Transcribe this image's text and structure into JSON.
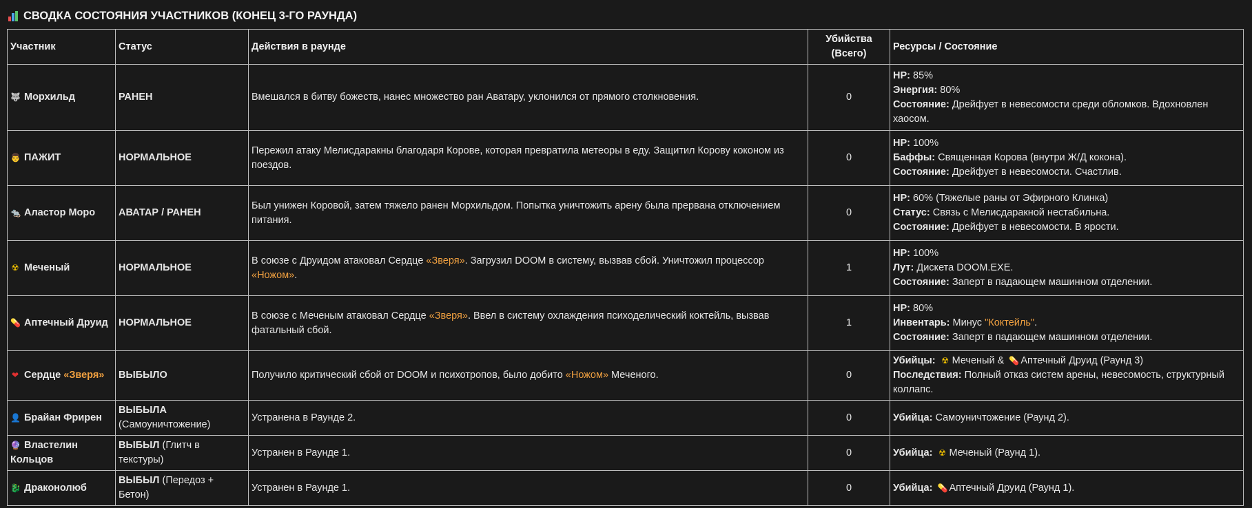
{
  "title": "СВОДКА СОСТОЯНИЯ УЧАСТНИКОВ (КОНЕЦ 3-ГО РАУНДА)",
  "title_icon": "bar-chart-icon",
  "headers": {
    "participant": "Участник",
    "status": "Статус",
    "actions": "Действия в раунде",
    "kills_line1": "Убийства",
    "kills_line2": "(Всего)",
    "resources": "Ресурсы / Состояние"
  },
  "rows": [
    {
      "icon": "wolf-icon",
      "glyph": "🐺",
      "name": "Морхильд",
      "status": "РАНЕН",
      "actions": "Вмешался в битву божеств, нанес множество ран Аватару, уклонился от прямого столкновения.",
      "kills": "0",
      "res": [
        {
          "k": "HP:",
          "v": " 85%"
        },
        {
          "k": "Энергия:",
          "v": " 80%"
        },
        {
          "k": "Состояние:",
          "v": " Дрейфует в невесомости среди обломков. Вдохновлен хаосом."
        }
      ]
    },
    {
      "icon": "man-face-icon",
      "glyph": "👨",
      "name": "ПАЖИТ",
      "status": "НОРМАЛЬНОЕ",
      "actions": "Пережил атаку Мелисдаракны благодаря Корове, которая превратила метеоры в еду. Защитил Корову коконом из поездов.",
      "kills": "0",
      "res": [
        {
          "k": "HP:",
          "v": " 100%"
        },
        {
          "k": "Баффы:",
          "v": " Священная Корова (внутри Ж/Д кокона)."
        },
        {
          "k": "Состояние:",
          "v": " Дрейфует в невесомости. Счастлив."
        }
      ]
    },
    {
      "icon": "rat-icon",
      "glyph": "🐀",
      "name": "Аластор Моро",
      "status": "АВАТАР / РАНЕН",
      "actions": "Был унижен Коровой, затем тяжело ранен Морхильдом. Попытка уничтожить арену была прервана отключением питания.",
      "kills": "0",
      "res": [
        {
          "k": "HP:",
          "v": " 60% (Тяжелые раны от Эфирного Клинка)"
        },
        {
          "k": "Статус:",
          "v": " Связь с Мелисдаракной нестабильна."
        },
        {
          "k": "Состояние:",
          "v": " Дрейфует в невесомости. В ярости."
        }
      ]
    },
    {
      "icon": "radioactive-icon",
      "glyph": "☢",
      "name": "Меченый",
      "status": "НОРМАЛЬНОЕ",
      "actions_a": "В союзе с Друидом атаковал Сердце ",
      "actions_hl1": "«Зверя»",
      "actions_b": ". Загрузил DOOM в систему, вызвав сбой. Уничтожил процессор ",
      "actions_hl2": "«Ножом»",
      "actions_c": ".",
      "kills": "1",
      "res": [
        {
          "k": "HP:",
          "v": " 100%"
        },
        {
          "k": "Лут:",
          "v": " Дискета DOOM.EXE."
        },
        {
          "k": "Состояние:",
          "v": " Заперт в падающем машинном отделении."
        }
      ]
    },
    {
      "icon": "pill-icon",
      "glyph": "💊",
      "name": "Аптечный Друид",
      "status": "НОРМАЛЬНОЕ",
      "actions_a": "В союзе с Меченым атаковал Сердце ",
      "actions_hl1": "«Зверя»",
      "actions_b": ". Ввел в систему охлаждения психоделический коктейль, вызвав фатальный сбой.",
      "kills": "1",
      "res_hp": {
        "k": "HP:",
        "v": " 80%"
      },
      "res_inv": {
        "k": "Инвентарь:",
        "v": " Минус ",
        "hl": "\"Коктейль\"",
        "end": "."
      },
      "res_state": {
        "k": "Состояние:",
        "v": " Заперт в падающем машинном отделении."
      }
    },
    {
      "icon": "heart-icon",
      "glyph": "❤",
      "name": "Сердце ",
      "name_hl": "«Зверя»",
      "status": "ВЫБЫЛО",
      "actions_a": "Получило критический сбой от DOOM и психотропов, было добито ",
      "actions_hl1": "«Ножом»",
      "actions_b": " Меченого.",
      "kills": "0",
      "killer_k": "Убийцы:",
      "killer_a": "Меченый & ",
      "killer_b": "Аптечный Друид (Раунд 3)",
      "conseq_k": "Последствия:",
      "conseq_v": " Полный отказ систем арены, невесомость, структурный коллапс."
    },
    {
      "icon": "person-icon",
      "glyph": "👤",
      "name": "Брайан Фрирен",
      "status": "ВЫБЫЛА",
      "status_note": "(Самоуничтожение)",
      "actions": "Устранена в Раунде 2.",
      "kills": "0",
      "killer_k": "Убийца:",
      "killer_v": " Самоуничтожение (Раунд 2)."
    },
    {
      "icon": "crystal-ball-icon",
      "glyph": "🔮",
      "name": "Властелин Кольцов",
      "status": "ВЫБЫЛ",
      "status_note": " (Глитч в текстуры)",
      "actions": "Устранен в Раунде 1.",
      "kills": "0",
      "killer_k": "Убийца:",
      "killer_v": "Меченый (Раунд 1)."
    },
    {
      "icon": "dragon-icon",
      "glyph": "🐉",
      "name": "Драконолюб",
      "status": "ВЫБЫЛ",
      "status_note": " (Передоз + Бетон)",
      "actions": "Устранен в Раунде 1.",
      "kills": "0",
      "killer_k": "Убийца:",
      "killer_v": "Аптечный Друид (Раунд 1)."
    }
  ],
  "colors": {
    "background": "#1a1a1a",
    "text": "#e6e6e6",
    "highlight": "#f0a040",
    "border": "#bdbdbd"
  }
}
